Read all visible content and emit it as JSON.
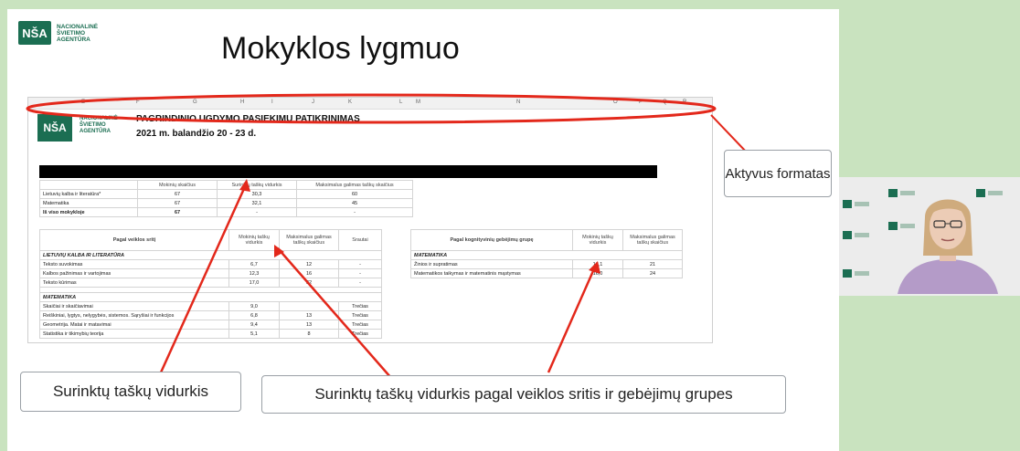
{
  "slide": {
    "logo_mark": "NŠA",
    "logo_text": "NACIONALINĖ ŠVIETIMO AGENTŪRA",
    "title": "Mokyklos lygmuo"
  },
  "sheet": {
    "column_letters": [
      "E",
      "F",
      "G",
      "H",
      "I",
      "J",
      "K",
      "L",
      "M",
      "N",
      "O",
      "P",
      "Q",
      "R"
    ],
    "logo_mark": "NŠA",
    "logo_text": "NACIONALINĖ ŠVIETIMO AGENTŪRA",
    "title": "PAGRINDINIO UGDYMO PASIEKIMŲ PATIKRINIMAS",
    "date": "2021 m. balandžio 20 - 23 d.",
    "summary": {
      "headers": [
        "",
        "Mokinių skaičius",
        "Surinktų taškų vidurkis",
        "Maksimalus galimas taškų skaičius"
      ],
      "rows": [
        [
          "Lietuvių kalba ir literatūra*",
          "67",
          "30,3",
          "60"
        ],
        [
          "Matematika",
          "67",
          "32,1",
          "45"
        ],
        [
          "Iš viso mokykloje",
          "67",
          "-",
          "-"
        ]
      ]
    },
    "areas": {
      "headers": [
        "Pagal veiklos sritį",
        "Mokinių taškų vidurkis",
        "Maksimalus galimas taškų skaičius",
        "Srautai"
      ],
      "sections": [
        {
          "name": "LIETUVIŲ KALBA IR LITERATŪRA",
          "rows": [
            [
              "Teksto suvokimas",
              "6,7",
              "12",
              "-"
            ],
            [
              "Kalbos pažinimas ir vartojimas",
              "12,3",
              "16",
              "-"
            ],
            [
              "Teksto kūrimas",
              "17,0",
              "32",
              "-"
            ]
          ]
        },
        {
          "name": "MATEMATIKA",
          "rows": [
            [
              "Skaičiai ir skaičiavimai",
              "9,0",
              "",
              "Trečias"
            ],
            [
              "Reiškiniai, lygtys, nelygybės, sistemos. Sąryšiai ir funkcijos",
              "6,8",
              "13",
              "Trečias"
            ],
            [
              "Geometrija. Matai ir matavimai",
              "9,4",
              "13",
              "Trečias"
            ],
            [
              "Statistika ir tikimybių teorija",
              "5,1",
              "8",
              "Trečias"
            ]
          ]
        }
      ]
    },
    "abilities": {
      "headers": [
        "Pagal kognityvinių gebėjimų grupę",
        "Mokinių taškų vidurkis",
        "Maksimalus galimas taškų skaičius"
      ],
      "section": "MATEMATIKA",
      "rows": [
        [
          "Žinios ir supratimas",
          "16,1",
          "21"
        ],
        [
          "Matematikos taikymas ir matematinis mąstymas",
          "16,0",
          "24"
        ]
      ]
    }
  },
  "callouts": {
    "aktyvus": "Aktyvus formatas",
    "surinktu": "Surinktų taškų vidurkis",
    "surinktu_pagal": "Surinktų taškų vidurkis pagal veiklos sritis ir gebėjimų grupes"
  },
  "colors": {
    "brand_green": "#1b6e52",
    "annotation_red": "#e3281b",
    "frame_green": "#c9e3bf"
  }
}
